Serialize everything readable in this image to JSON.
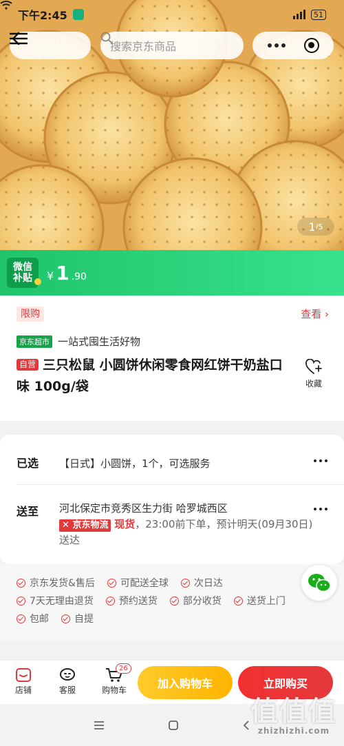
{
  "status": {
    "time": "下午2:45",
    "battery": "51"
  },
  "topbar": {
    "search_placeholder": "搜索京东商品"
  },
  "hero": {
    "index": "1",
    "total": "/5"
  },
  "price": {
    "badge_line1": "微信",
    "badge_line2": "补贴",
    "currency": "¥",
    "integer": "1",
    "decimal": ".90"
  },
  "info": {
    "limit_tag": "限购",
    "check_more": "查看",
    "jd_tag": "京东超市",
    "slogan": "一站式囤生活好物",
    "self_tag": "自营",
    "title": "三只松鼠 小圆饼休闲零食网红饼干奶盐口味 100g/袋",
    "favorite_label": "收藏"
  },
  "selection": {
    "selected_label": "已选",
    "selected_value": "【日式】小圆饼，1个，可选服务",
    "ship_label": "送至",
    "address": "河北保定市竞秀区生力街 哈罗城西区",
    "logistics_tag": "京东物流",
    "stock": "现货",
    "delivery": "，23:00前下单，预计明天(09月30日)送达"
  },
  "services": {
    "line1": [
      "京东发货&售后",
      "可配送全球",
      "次日达"
    ],
    "line2": [
      "7天无理由退货",
      "预约送货",
      "部分收货",
      "送货上门"
    ],
    "line3": [
      "包邮",
      "自提"
    ]
  },
  "bottom": {
    "store": "店铺",
    "service": "客服",
    "cart": "购物车",
    "cart_count": "26",
    "add_to_cart": "加入购物车",
    "buy_now": "立即购买"
  },
  "watermark": {
    "main": "值值值",
    "sub": "zhizhizhi.com"
  }
}
